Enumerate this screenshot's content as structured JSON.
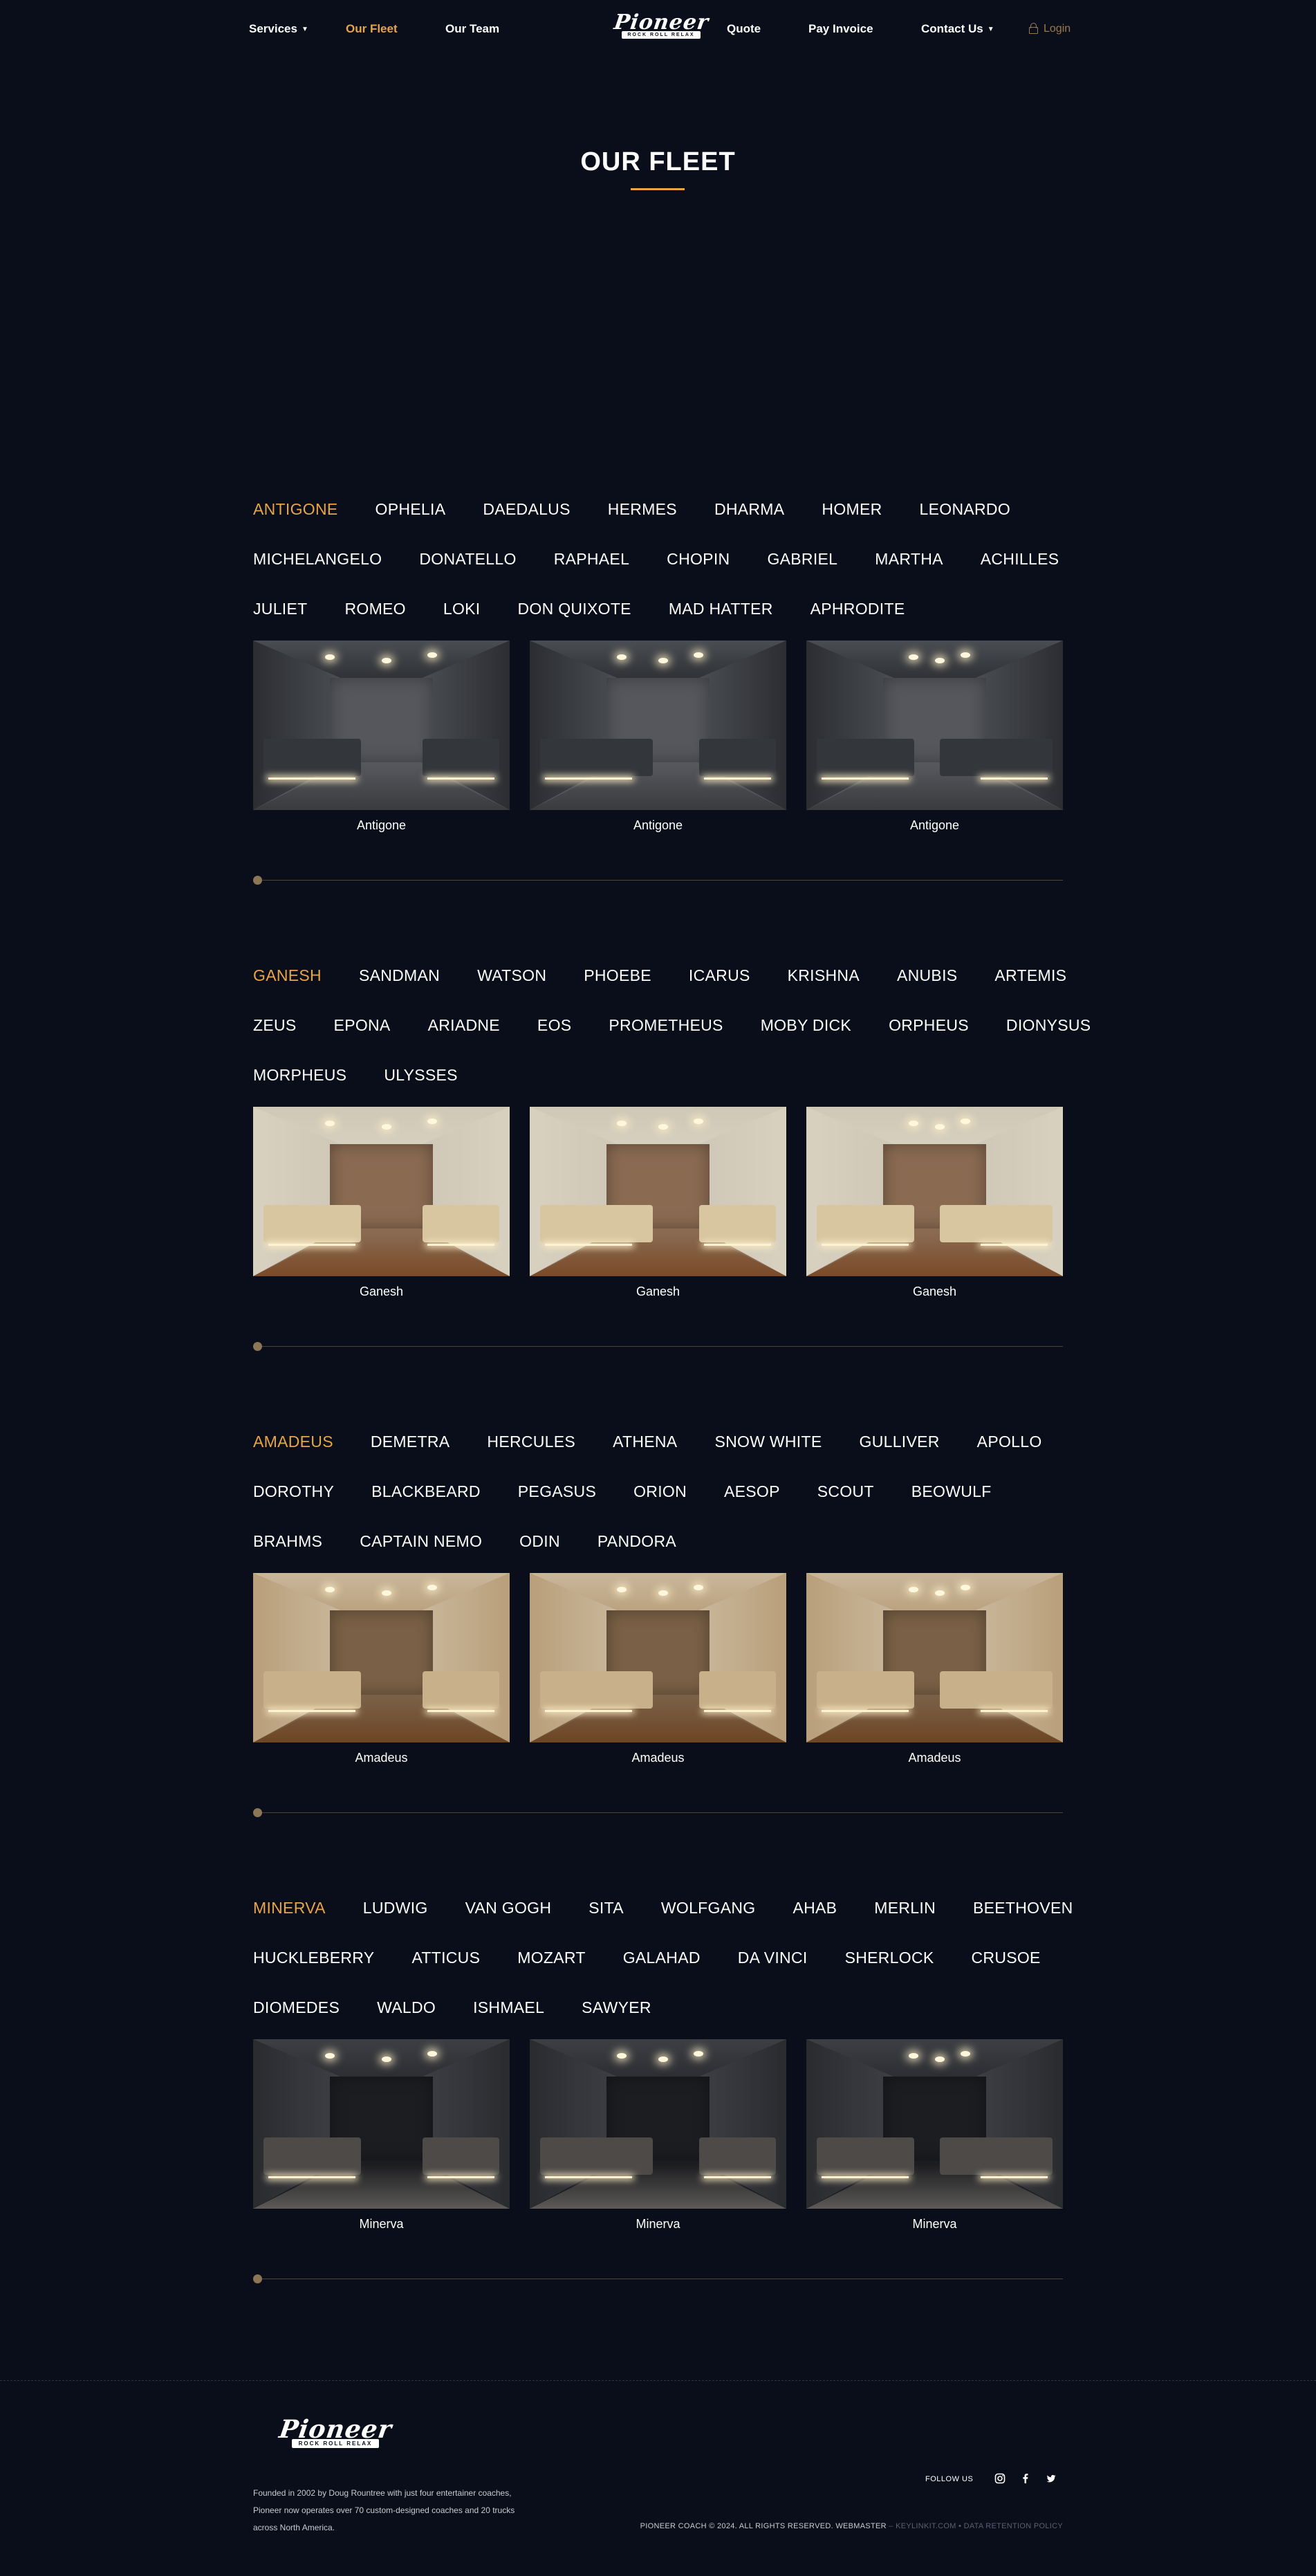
{
  "nav": {
    "services": "Services",
    "our_fleet": "Our Fleet",
    "our_team": "Our Team",
    "quote": "Quote",
    "pay_invoice": "Pay Invoice",
    "contact_us": "Contact Us",
    "login": "Login"
  },
  "logo": {
    "wordmark": "Pioneer",
    "tagline": "ROCK ROLL RELAX"
  },
  "page_title": "OUR FLEET",
  "colors": {
    "accent": "#e8a448",
    "background": "#0a0e1a"
  },
  "sections": [
    {
      "tab_rows": [
        [
          "ANTIGONE",
          "OPHELIA",
          "DAEDALUS",
          "HERMES",
          "DHARMA",
          "HOMER",
          "LEONARDO"
        ],
        [
          "MICHELANGELO",
          "DONATELLO",
          "RAPHAEL",
          "CHOPIN",
          "GABRIEL",
          "MARTHA",
          "ACHILLES"
        ],
        [
          "JULIET",
          "ROMEO",
          "LOKI",
          "DON QUIXOTE",
          "MAD HATTER",
          "APHRODITE"
        ]
      ],
      "active_tab": "ANTIGONE",
      "captions": [
        "Antigone",
        "Antigone",
        "Antigone"
      ],
      "theme": "dark-grey"
    },
    {
      "tab_rows": [
        [
          "GANESH",
          "SANDMAN",
          "WATSON",
          "PHOEBE",
          "ICARUS",
          "KRISHNA",
          "ANUBIS",
          "ARTEMIS"
        ],
        [
          "ZEUS",
          "EPONA",
          "ARIADNE",
          "EOS",
          "PROMETHEUS",
          "MOBY DICK",
          "ORPHEUS",
          "DIONYSUS"
        ],
        [
          "MORPHEUS",
          "ULYSSES"
        ]
      ],
      "active_tab": "GANESH",
      "captions": [
        "Ganesh",
        "Ganesh",
        "Ganesh"
      ],
      "theme": "cream-wood"
    },
    {
      "tab_rows": [
        [
          "AMADEUS",
          "DEMETRA",
          "HERCULES",
          "ATHENA",
          "SNOW WHITE",
          "GULLIVER",
          "APOLLO"
        ],
        [
          "DOROTHY",
          "BLACKBEARD",
          "PEGASUS",
          "ORION",
          "AESOP",
          "SCOUT",
          "BEOWULF"
        ],
        [
          "BRAHMS",
          "CAPTAIN NEMO",
          "ODIN",
          "PANDORA"
        ]
      ],
      "active_tab": "AMADEUS",
      "captions": [
        "Amadeus",
        "Amadeus",
        "Amadeus"
      ],
      "theme": "warm-beige"
    },
    {
      "tab_rows": [
        [
          "MINERVA",
          "LUDWIG",
          "VAN GOGH",
          "SITA",
          "WOLFGANG",
          "AHAB",
          "MERLIN",
          "BEETHOVEN"
        ],
        [
          "HUCKLEBERRY",
          "ATTICUS",
          "MOZART",
          "GALAHAD",
          "DA VINCI",
          "SHERLOCK",
          "CRUSOE"
        ],
        [
          "DIOMEDES",
          "WALDO",
          "ISHMAEL",
          "SAWYER"
        ]
      ],
      "active_tab": "MINERVA",
      "captions": [
        "Minerva",
        "Minerva",
        "Minerva"
      ],
      "theme": "charcoal"
    }
  ],
  "footer": {
    "about": "Founded in 2002 by Doug Rountree with just four entertainer coaches, Pioneer now operates over 70 custom-designed coaches and 20 trucks across North America.",
    "follow_us": "FOLLOW US",
    "social_icons": [
      "instagram-icon",
      "facebook-icon",
      "twitter-icon"
    ],
    "copyright": "PIONEER COACH © 2024. ALL RIGHTS RESERVED. WEBMASTER",
    "webmaster_link": "KEYLINKIT.COM",
    "retention_link": "DATA RETENTION POLICY"
  }
}
